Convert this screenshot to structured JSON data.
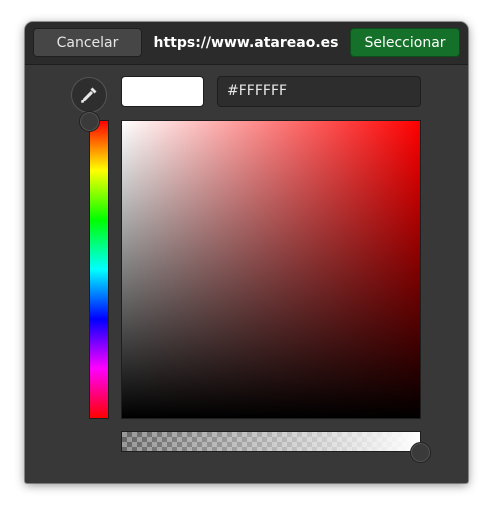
{
  "header": {
    "cancel_label": "Cancelar",
    "title": "https://www.atareao.es",
    "select_label": "Seleccionar"
  },
  "color": {
    "hex_value": "#FFFFFF",
    "current_swatch": "#FFFFFF",
    "hue_color": "#FF0000",
    "alpha_fraction": 1.0
  },
  "icons": {
    "picker": "eyedropper-icon"
  },
  "colors": {
    "accent_button": "#15712A",
    "window_bg": "#383838",
    "header_bg": "#2B2B2B"
  }
}
